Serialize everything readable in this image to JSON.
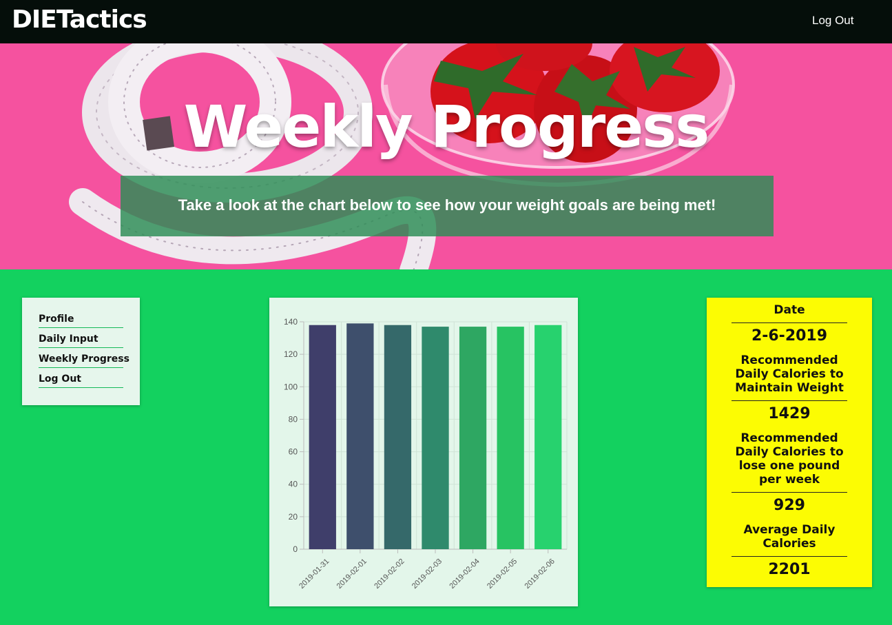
{
  "navbar": {
    "brand": "DIETactics",
    "logout_label": "Log Out"
  },
  "hero": {
    "title": "Weekly Progress",
    "subtitle": "Take a look at the chart below to see how your weight goals are being met!"
  },
  "sidebar": {
    "items": [
      {
        "label": "Profile"
      },
      {
        "label": "Daily Input"
      },
      {
        "label": "Weekly Progress"
      },
      {
        "label": "Log Out"
      }
    ]
  },
  "chart_data": {
    "type": "bar",
    "categories": [
      "2019-01-31",
      "2019-02-01",
      "2019-02-02",
      "2019-02-03",
      "2019-02-04",
      "2019-02-05",
      "2019-02-06"
    ],
    "values": [
      138,
      139,
      138,
      137,
      137,
      137,
      138
    ],
    "bar_colors": [
      "#3f3e6a",
      "#3e4f6c",
      "#35696a",
      "#2f8a6c",
      "#2ea762",
      "#27c362",
      "#27d26e"
    ],
    "ylim": [
      0,
      140
    ],
    "yticks": [
      0,
      20,
      40,
      60,
      80,
      100,
      120,
      140
    ],
    "grid": true,
    "title": "",
    "xlabel": "",
    "ylabel": ""
  },
  "stats": {
    "date_label": "Date",
    "date_value": "2-6-2019",
    "maintain_label_lines": [
      "Recommended",
      "Daily Calories to",
      "Maintain Weight"
    ],
    "maintain_value": "1429",
    "lose_label_lines": [
      "Recommended",
      "Daily Calories to",
      "lose one pound",
      "per week"
    ],
    "lose_value": "929",
    "average_label_lines": [
      "Average Daily",
      "Calories"
    ],
    "average_value": "2201"
  },
  "colors": {
    "navbar": "#050e0a",
    "page_background": "#13d15f",
    "hero_background": "#f5529f",
    "stats_card": "#fcfc03"
  }
}
